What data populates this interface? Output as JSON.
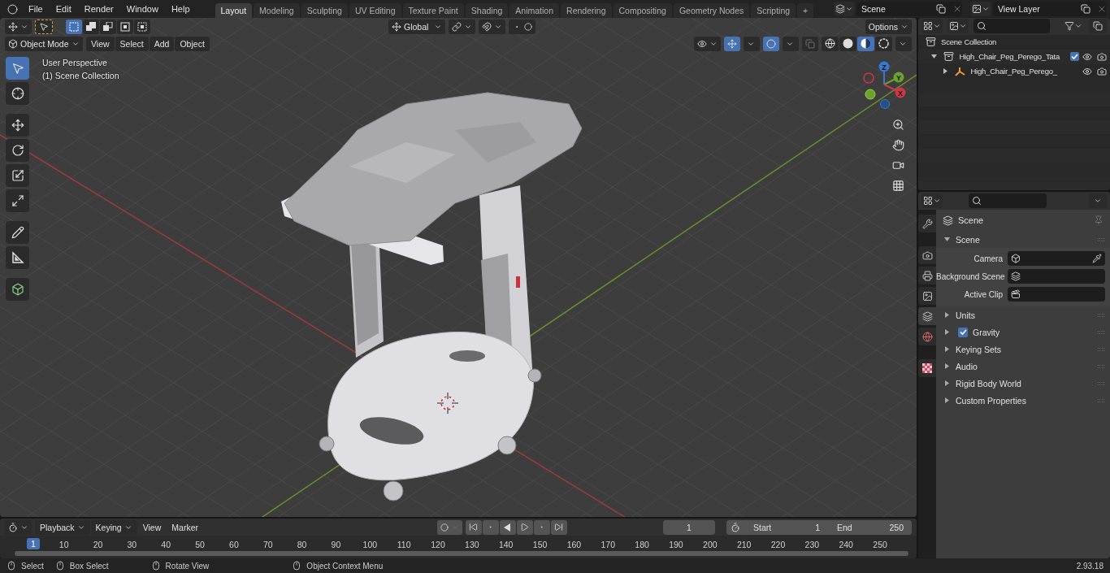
{
  "menu": [
    "File",
    "Edit",
    "Render",
    "Window",
    "Help"
  ],
  "workspaces": [
    {
      "label": "Layout",
      "selected": true
    },
    {
      "label": "Modeling",
      "selected": false
    },
    {
      "label": "Sculpting",
      "selected": false
    },
    {
      "label": "UV Editing",
      "selected": false
    },
    {
      "label": "Texture Paint",
      "selected": false
    },
    {
      "label": "Shading",
      "selected": false
    },
    {
      "label": "Animation",
      "selected": false
    },
    {
      "label": "Rendering",
      "selected": false
    },
    {
      "label": "Compositing",
      "selected": false
    },
    {
      "label": "Geometry Nodes",
      "selected": false
    },
    {
      "label": "Scripting",
      "selected": false
    }
  ],
  "add_workspace": "+",
  "scene_field": "Scene",
  "view_layer_field": "View Layer",
  "viewport": {
    "select_modes": [
      {
        "kind": "set",
        "selected": true
      },
      {
        "kind": "extend",
        "selected": false
      },
      {
        "kind": "subtract",
        "selected": false
      },
      {
        "kind": "invert",
        "selected": false
      },
      {
        "kind": "intersect",
        "selected": false
      }
    ],
    "transform_orientation": "Global",
    "options": "Options",
    "mode": "Object Mode",
    "menus": [
      "View",
      "Select",
      "Add",
      "Object"
    ],
    "gizmos_on": true,
    "overlays_on": true,
    "shading_modes": [
      {
        "kind": "wireframe",
        "selected": false
      },
      {
        "kind": "solid",
        "selected": false
      },
      {
        "kind": "material",
        "selected": true
      },
      {
        "kind": "rendered",
        "selected": false
      }
    ],
    "overlay_text": [
      "User Perspective",
      "(1) Scene Collection"
    ],
    "tools": [
      {
        "kind": "select",
        "selected": true
      },
      {
        "kind": "cursor",
        "selected": false
      },
      {
        "kind": "move",
        "selected": false
      },
      {
        "kind": "rotate",
        "selected": false
      },
      {
        "kind": "scale",
        "selected": false
      },
      {
        "kind": "transform",
        "selected": false
      },
      {
        "kind": "annotate",
        "selected": false
      },
      {
        "kind": "measure",
        "selected": false
      },
      {
        "kind": "add_cube",
        "selected": false
      }
    ],
    "axes": [
      {
        "label": "Z"
      },
      {
        "label": "Y"
      },
      {
        "label": "X"
      }
    ]
  },
  "outliner": {
    "items": [
      {
        "label": "Scene Collection",
        "kind": "scene",
        "children": [
          {
            "label": "High_Chair_Peg_Perego_Tata",
            "kind": "collection",
            "expanded": true,
            "checked": true,
            "children": [
              {
                "label": "High_Chair_Peg_Perego_",
                "kind": "object",
                "expanded": false
              }
            ]
          }
        ]
      }
    ]
  },
  "properties": {
    "tabs": [
      {
        "kind": "tool",
        "selected": false
      },
      {
        "kind": "render",
        "selected": false
      },
      {
        "kind": "output",
        "selected": false
      },
      {
        "kind": "view_layer",
        "selected": false
      },
      {
        "kind": "scene",
        "selected": true
      },
      {
        "kind": "world",
        "selected": false
      },
      {
        "kind": "texture",
        "selected": false
      }
    ],
    "context": "Scene",
    "panels": [
      {
        "label": "Scene",
        "kind": "plain",
        "expanded": true,
        "fields": [
          {
            "label": "Camera",
            "kind": "camera"
          },
          {
            "label": "Background Scene",
            "kind": "scene"
          },
          {
            "label": "Active Clip",
            "kind": "clip"
          }
        ]
      },
      {
        "label": "Units",
        "kind": "plain",
        "expanded": false
      },
      {
        "label": "Gravity",
        "kind": "toggle",
        "expanded": false,
        "checked": true
      },
      {
        "label": "Keying Sets",
        "kind": "plain",
        "expanded": false
      },
      {
        "label": "Audio",
        "kind": "plain",
        "expanded": false
      },
      {
        "label": "Rigid Body World",
        "kind": "plain",
        "expanded": false
      },
      {
        "label": "Custom Properties",
        "kind": "plain",
        "expanded": false
      }
    ]
  },
  "timeline": {
    "menus": [
      {
        "label": "Playback",
        "kind": "dropdown"
      },
      {
        "label": "Keying",
        "kind": "dropdown"
      },
      {
        "label": "View",
        "kind": "menu"
      },
      {
        "label": "Marker",
        "kind": "menu"
      }
    ],
    "current_frame": "1",
    "start_label": "Start",
    "start": "1",
    "end_label": "End",
    "end": "250",
    "playhead": "1",
    "ticks": [
      "10",
      "20",
      "30",
      "40",
      "50",
      "60",
      "70",
      "80",
      "90",
      "100",
      "110",
      "120",
      "130",
      "140",
      "150",
      "160",
      "170",
      "180",
      "190",
      "200",
      "210",
      "220",
      "230",
      "240",
      "250"
    ]
  },
  "status_bar": {
    "hints": [
      "Select",
      "Box Select",
      "Rotate View",
      "Object Context Menu"
    ],
    "version": "2.93.18"
  }
}
